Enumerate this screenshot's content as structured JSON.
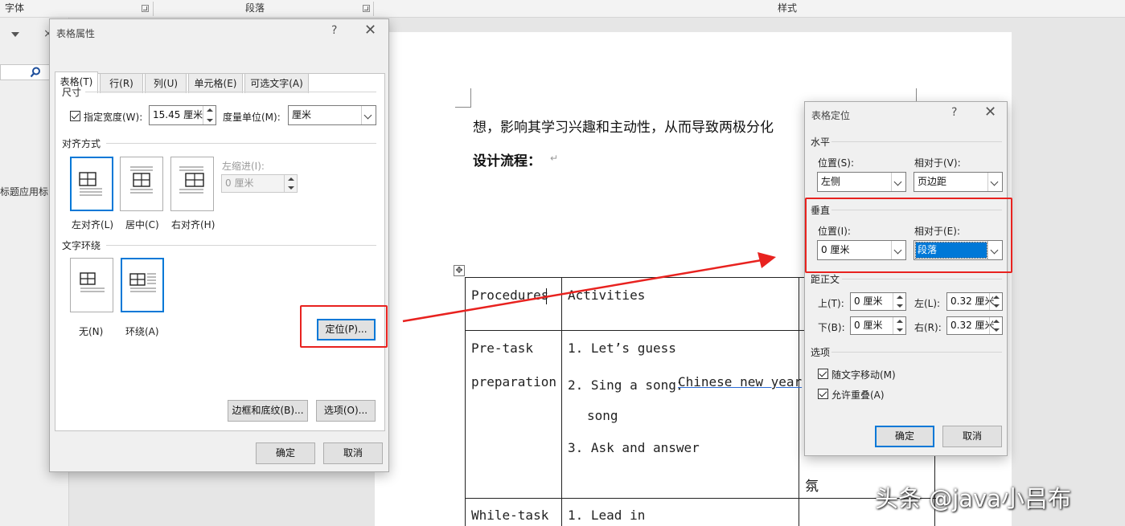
{
  "ribbon": {
    "font_group": "字体",
    "paragraph_group": "段落",
    "styles_group": "样式"
  },
  "navpane": {
    "heading_label": "标题应用标"
  },
  "document": {
    "line1": "想，影响其学习兴趣和主动性，从而导致两极分化",
    "design_label": "设计流程：",
    "table": {
      "header": [
        "Procedures",
        "Activities"
      ],
      "pretask_label_line1": "Pre-task",
      "pretask_label_line2": "preparation",
      "pretask_items": [
        "1. Let’s guess",
        "2. Sing a song：",
        "Chinese new year",
        "song",
        "3. Ask and answer"
      ],
      "third_col_char": "氛",
      "whiletask_label": "While-task",
      "whiletask_item": "1. Lead in"
    }
  },
  "table_props": {
    "title": "表格属性",
    "tabs": [
      "表格(T)",
      "行(R)",
      "列(U)",
      "单元格(E)",
      "可选文字(A)"
    ],
    "size_section": "尺寸",
    "preferred_width_label": "指定宽度(W):",
    "preferred_width_value": "15.45 厘米",
    "measure_in_label": "度量单位(M):",
    "measure_in_value": "厘米",
    "alignment_section": "对齐方式",
    "align_left": "左对齐(L)",
    "align_center": "居中(C)",
    "align_right": "右对齐(H)",
    "indent_label": "左缩进(I):",
    "indent_value": "0 厘米",
    "wrap_section": "文字环绕",
    "wrap_none": "无(N)",
    "wrap_around": "环绕(A)",
    "positioning_button": "定位(P)...",
    "borders_button": "边框和底纹(B)...",
    "options_button": "选项(O)...",
    "ok_button": "确定",
    "cancel_button": "取消"
  },
  "positioning": {
    "title": "表格定位",
    "horizontal_section": "水平",
    "h_position_label": "位置(S):",
    "h_position_value": "左侧",
    "h_relative_label": "相对于(V):",
    "h_relative_value": "页边距",
    "vertical_section": "垂直",
    "v_position_label": "位置(I):",
    "v_position_value": "0 厘米",
    "v_relative_label": "相对于(E):",
    "v_relative_value": "段落",
    "distance_section": "距正文",
    "top_label": "上(T):",
    "top_value": "0 厘米",
    "bottom_label": "下(B):",
    "bottom_value": "0 厘米",
    "left_label": "左(L):",
    "left_value": "0.32 厘米",
    "right_label": "右(R):",
    "right_value": "0.32 厘米",
    "options_section": "选项",
    "move_with_text": "随文字移动(M)",
    "allow_overlap": "允许重叠(A)",
    "ok_button": "确定",
    "cancel_button": "取消"
  },
  "watermark": "头条 @java小吕布",
  "colors": {
    "highlight": "#e8221f",
    "accent": "#0078d7"
  }
}
